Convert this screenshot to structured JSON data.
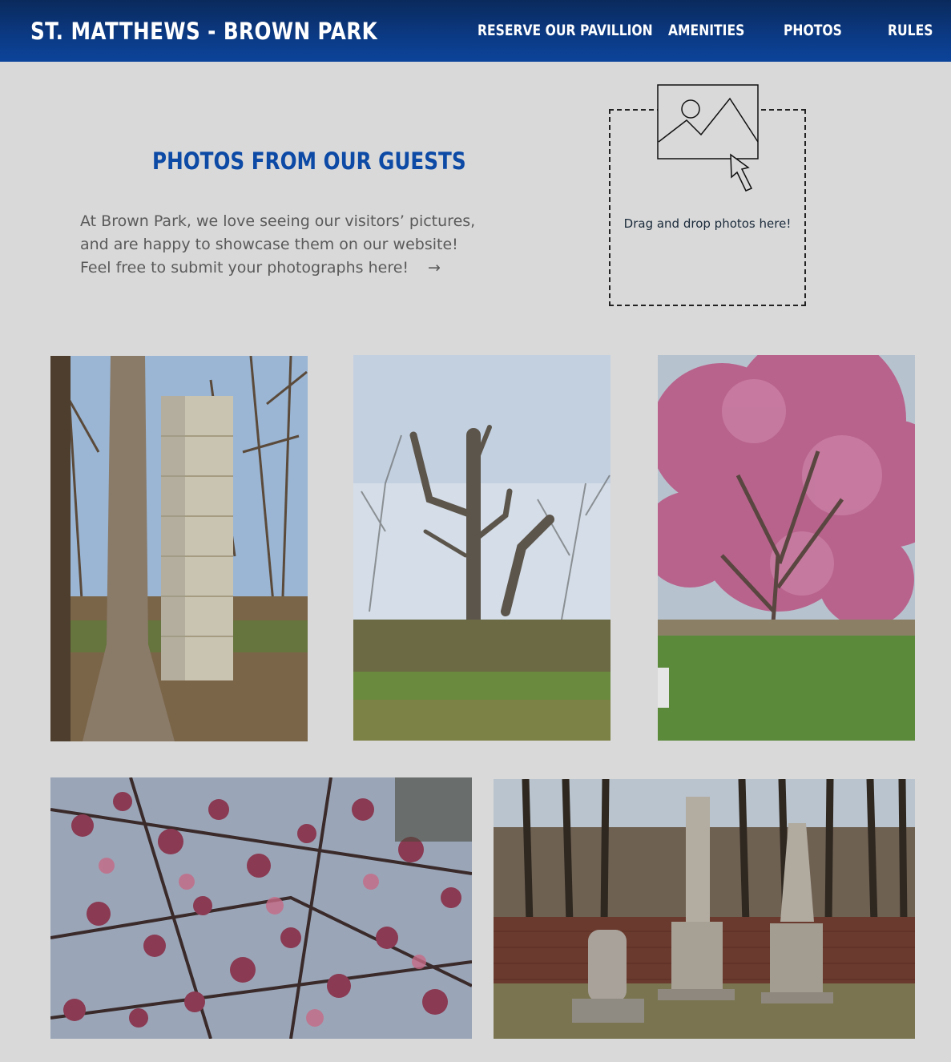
{
  "site": {
    "brand": "ST. MATTHEWS - BROWN PARK"
  },
  "nav": {
    "items": [
      {
        "label": "RESERVE OUR PAVILLION"
      },
      {
        "label": "AMENITIES"
      },
      {
        "label": "PHOTOS"
      },
      {
        "label": "RULES"
      }
    ]
  },
  "gallery": {
    "title": "PHOTOS FROM OUR GUESTS",
    "intro": [
      "At Brown Park, we love seeing our visitors’ pictures,",
      "and are happy to showcase them on our website!",
      "Feel free to submit your photographs here!"
    ],
    "arrow": "→",
    "dropzone_text": "Drag and drop photos here!",
    "dropzone_icon": "image-upload-icon"
  },
  "colors": {
    "nav_bg": "#0b3a85",
    "title": "#0c4aa6",
    "page_bg": "#d9d9d9"
  }
}
